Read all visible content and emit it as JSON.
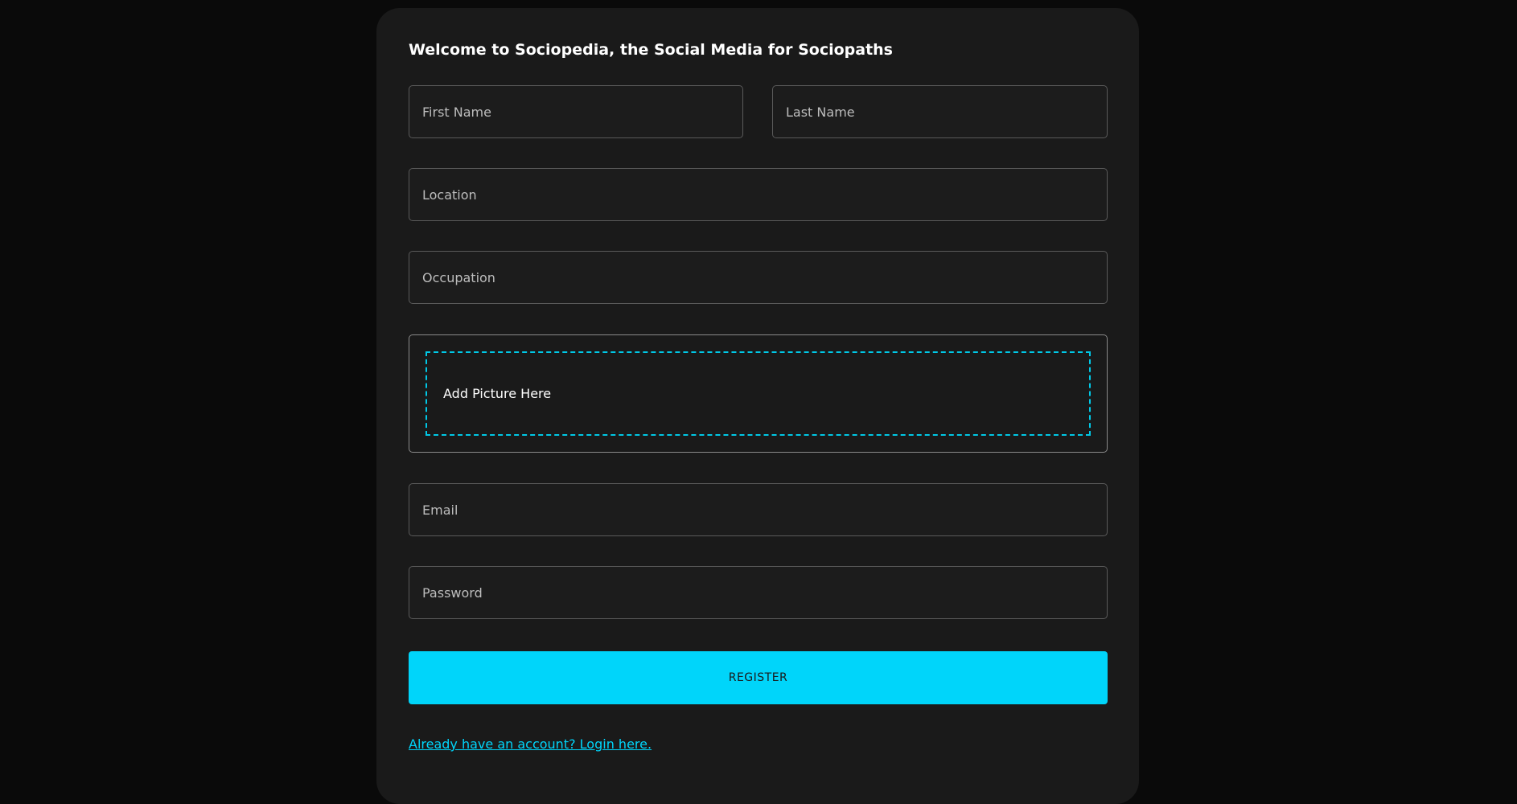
{
  "form": {
    "title": "Welcome to Sociopedia, the Social Media for Sociopaths",
    "first_name_placeholder": "First Name",
    "last_name_placeholder": "Last Name",
    "location_placeholder": "Location",
    "occupation_placeholder": "Occupation",
    "picture_label": "Add Picture Here",
    "email_placeholder": "Email",
    "password_placeholder": "Password",
    "register_label": "REGISTER",
    "login_link": "Already have an account? Login here."
  },
  "colors": {
    "accent": "#00d5fa",
    "card_background": "#1a1a1a",
    "page_background": "#0a0a0a"
  }
}
